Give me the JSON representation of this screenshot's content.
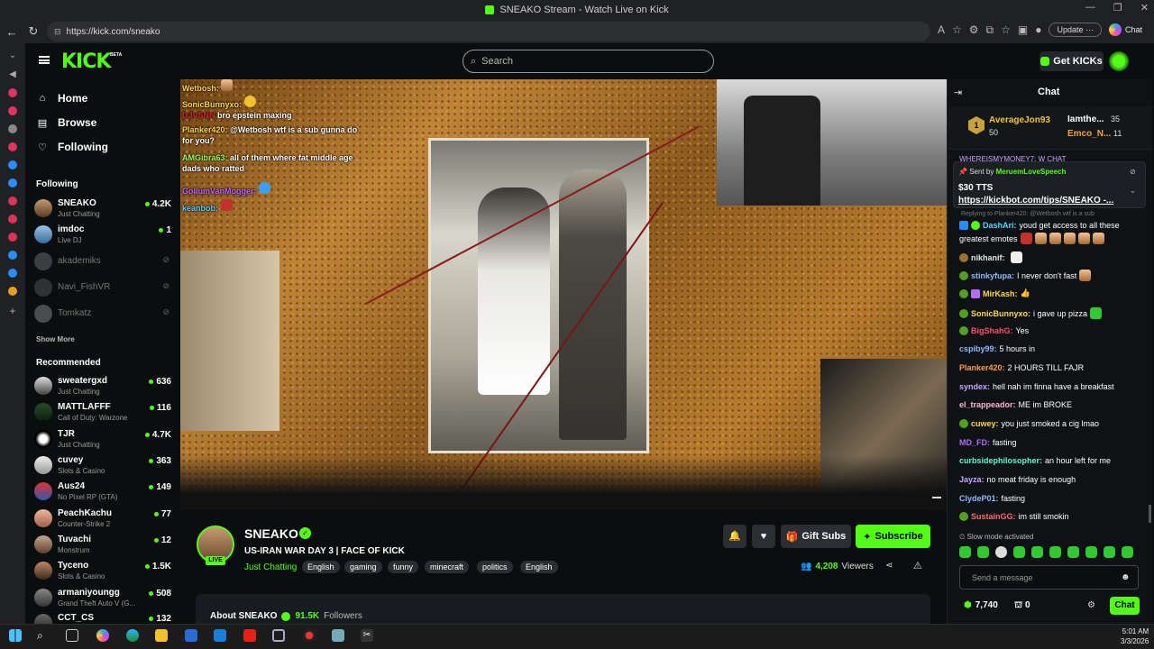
{
  "browser": {
    "title": "SNEAKO Stream - Watch Live on Kick",
    "url": "https://kick.com/sneako",
    "update_label": "Update",
    "chat_label": "Chat"
  },
  "header": {
    "logo": "KICK",
    "beta": "BETA",
    "search_placeholder": "Search",
    "getkicks": "Get KICKs"
  },
  "nav": {
    "home": "Home",
    "browse": "Browse",
    "following": "Following"
  },
  "sidebar": {
    "following_title": "Following",
    "following": [
      {
        "name": "SNEAKO",
        "game": "Just Chatting",
        "viewers": "4.2K"
      },
      {
        "name": "imdoc",
        "game": "Live DJ",
        "viewers": "1"
      },
      {
        "name": "akademiks"
      },
      {
        "name": "Navi_FishVR"
      },
      {
        "name": "Tomkatz"
      }
    ],
    "show_more": "Show More",
    "recommended_title": "Recommended",
    "recommended": [
      {
        "name": "sweatergxd",
        "game": "Just Chatting",
        "viewers": "636"
      },
      {
        "name": "MATTLAFFF",
        "game": "Call of Duty: Warzone",
        "viewers": "116"
      },
      {
        "name": "TJR",
        "game": "Just Chatting",
        "viewers": "4.7K"
      },
      {
        "name": "cuvey",
        "game": "Slots & Casino",
        "viewers": "363"
      },
      {
        "name": "Aus24",
        "game": "No Pixel RP (GTA)",
        "viewers": "149"
      },
      {
        "name": "PeachKachu",
        "game": "Counter-Strike 2",
        "viewers": "77"
      },
      {
        "name": "Tuvachi",
        "game": "Monstrum",
        "viewers": "12"
      },
      {
        "name": "Tyceno",
        "game": "Slots & Casino",
        "viewers": "1.5K"
      },
      {
        "name": "armaniyoungg",
        "game": "Grand Theft Auto V (G...",
        "viewers": "508"
      },
      {
        "name": "CCT_CS",
        "game": "",
        "viewers": "132"
      }
    ]
  },
  "overlay_chat": [
    {
      "user": "Wetbosh:",
      "text": ""
    },
    {
      "user": "SonicBunnyxo:",
      "text": ""
    },
    {
      "user": "DJVSNN",
      "text": "bro epstein maxing"
    },
    {
      "user": "Planker420:",
      "text": "@Wetbosh wtf is a sub gunna do for you?"
    },
    {
      "user": "AMGibra63:",
      "text": "all of them where fat middle age dads who ratted"
    },
    {
      "user": "GollumVanMogger:",
      "text": ""
    },
    {
      "user": "keanbob:",
      "text": ""
    }
  ],
  "channel": {
    "name": "SNEAKO",
    "live": "LIVE",
    "title": "US-IRAN WAR DAY 3 | FACE OF KICK",
    "category": "Just Chatting",
    "tags": [
      "English",
      "gaming",
      "funny",
      "minecraft",
      "politics",
      "English"
    ],
    "gift_subs": "Gift Subs",
    "subscribe": "Subscribe",
    "viewers": "4,208",
    "viewers_label": "Viewers",
    "about": "About SNEAKO",
    "followers": "91.5K",
    "followers_label": "Followers"
  },
  "chat": {
    "title": "Chat",
    "leaderboard": {
      "rank": "1",
      "first_name": "AverageJon93",
      "first_val": "50",
      "second_name": "Iamthe...",
      "second_val": "35",
      "third_name": "Emco_N...",
      "third_val": "11"
    },
    "partial_top": "WHEREISMYMONEY7: W CHAT",
    "pinned": {
      "sent_by": "Sent by",
      "sender": "MeruemLoveSpeech",
      "amount": "$30 TTS",
      "link": "https://kickbot.com/tips/SNEAKO -..."
    },
    "reply": "Replying to Planker420: @Wetbosh wtf is a sub",
    "messages": [
      {
        "user": "DashAri:",
        "text": "youd get access to all these",
        "color": "#53d9ff"
      },
      {
        "user": "",
        "text": "greatest emotes",
        "color": "#fff"
      },
      {
        "user": "nikhanif:",
        "text": "",
        "color": "#e6e6e6"
      },
      {
        "user": "stinkyfupa:",
        "text": "I never don't fast",
        "color": "#8fb9ff"
      },
      {
        "user": "MirKash:",
        "text": "👍",
        "color": "#ffd84d"
      },
      {
        "user": "SonicBunnyxo:",
        "text": "i gave up pizza",
        "color": "#ffd84d"
      },
      {
        "user": "BigShahG:",
        "text": "Yes",
        "color": "#ff4d6d"
      },
      {
        "user": "cspiby99:",
        "text": "5 hours in",
        "color": "#8fb9ff"
      },
      {
        "user": "Planker420:",
        "text": "2 HOURS TILL FAJR",
        "color": "#ff9a4d"
      },
      {
        "user": "syndex:",
        "text": "hell nah im finna have a breakfast",
        "color": "#c9a6ff"
      },
      {
        "user": "el_trappeador:",
        "text": "ME im BROKE",
        "color": "#ffb3d1"
      },
      {
        "user": "cuwey:",
        "text": "you just smoked a cig lmao",
        "color": "#ffd84d"
      },
      {
        "user": "MD_FD:",
        "text": "fasting",
        "color": "#b36bff"
      },
      {
        "user": "curbsidephilosopher:",
        "text": "an hour left for me",
        "color": "#53fcd0"
      },
      {
        "user": "Jayza:",
        "text": "no meat friday is enough",
        "color": "#c9a6ff"
      },
      {
        "user": "ClydeP01:",
        "text": "fasting",
        "color": "#8fb9ff"
      },
      {
        "user": "SustainGG:",
        "text": "im still smokin",
        "color": "#ff6b6b"
      }
    ],
    "slow_mode": "Slow mode activated",
    "placeholder": "Send a message",
    "kicks": "7,740",
    "points": "0",
    "chat_button": "Chat"
  },
  "taskbar": {
    "time": "5:01 AM",
    "date": "3/3/2026"
  }
}
